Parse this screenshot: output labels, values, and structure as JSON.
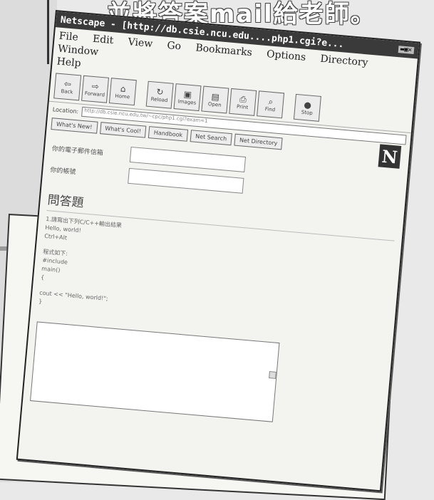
{
  "caption": "並將答案mail給老師。",
  "window": {
    "title": "Netscape - [http://db.csie.ncu.edu....php1.cgi?e...",
    "title_controls": "▬▣✕"
  },
  "menu": [
    "File",
    "Edit",
    "View",
    "Go",
    "Bookmarks",
    "Options",
    "Directory",
    "Window",
    "Help"
  ],
  "toolbar": [
    {
      "label": "Back",
      "icon": "back-icon",
      "glyph": "⇦"
    },
    {
      "label": "Forward",
      "icon": "forward-icon",
      "glyph": "⇨"
    },
    {
      "label": "Home",
      "icon": "home-icon",
      "glyph": "⌂"
    },
    {
      "label": "Reload",
      "icon": "reload-icon",
      "glyph": "↻"
    },
    {
      "label": "Images",
      "icon": "images-icon",
      "glyph": "▣"
    },
    {
      "label": "Open",
      "icon": "open-icon",
      "glyph": "▤"
    },
    {
      "label": "Print",
      "icon": "print-icon",
      "glyph": "⎙"
    },
    {
      "label": "Find",
      "icon": "find-icon",
      "glyph": "⌕"
    },
    {
      "label": "Stop",
      "icon": "stop-icon",
      "glyph": "●"
    }
  ],
  "location": {
    "label": "Location:",
    "url": "http://db.csie.ncu.edu.tw/~cpc/php1.cgi?exam=1"
  },
  "directory_buttons": [
    "What's New!",
    "What's Cool!",
    "Handbook",
    "Net Search",
    "Net Directory"
  ],
  "logo": "N",
  "form": {
    "email_label": "你的電子郵件信箱",
    "id_label": "你的帳號"
  },
  "content": {
    "section_title": "問答題",
    "lines_a": [
      "1.請寫出下列C/C++輸出結果",
      "Hello, world!",
      "Ctrl+Alt"
    ],
    "lines_b": [
      "程式如下:",
      "#include",
      "main()",
      "{",
      "cout << \"Hello, world!\";",
      "}"
    ]
  }
}
